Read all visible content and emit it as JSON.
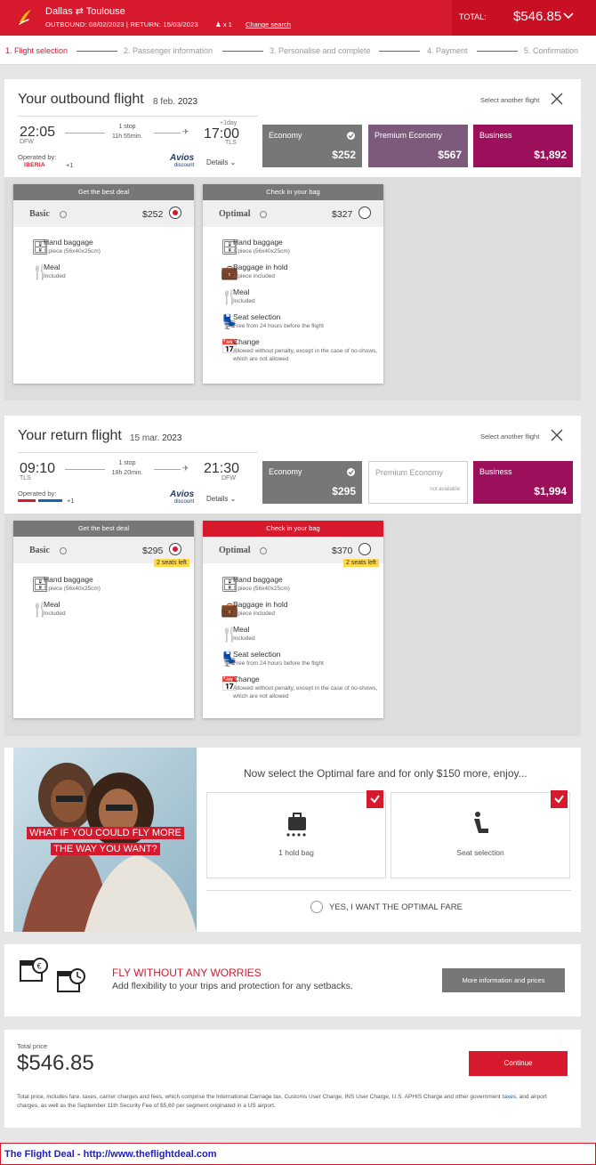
{
  "header": {
    "route": "Dallas ⇄ Toulouse",
    "dates": "OUTBOUND: 08/02/2023 | RETURN: 15/03/2023",
    "passengers": "x 1",
    "change_search": "Change search",
    "total_label": "TOTAL:",
    "total_value": "$546.85",
    "brand_color": "#d7192d"
  },
  "steps": [
    {
      "label": "1. Flight selection",
      "active": true
    },
    {
      "label": "2. Passenger information"
    },
    {
      "label": "3. Personalise and complete"
    },
    {
      "label": "4. Payment"
    },
    {
      "label": "5. Confirmation"
    }
  ],
  "outbound": {
    "title": "Your outbound flight",
    "date_a": "8 feb.",
    "date_b": "2023",
    "select_another": "Select another flight",
    "dep_time": "22:05",
    "dep_airport": "DFW",
    "stops": "1 stop",
    "duration": "11h 55min.",
    "plus_day": "+1day",
    "arr_time": "17:00",
    "arr_airport": "TLS",
    "operated_by": "Operated by:",
    "airline": "IBERIA",
    "plus": "+1",
    "avios": "Avios",
    "avios_sub": "discount",
    "details": "Details ⌄",
    "cabins": [
      {
        "name": "Economy",
        "price": "$252",
        "color": "#777777"
      },
      {
        "name": "Premium Economy",
        "price": "$567",
        "color": "#7d5a7b"
      },
      {
        "name": "Business",
        "price": "$1,892",
        "color": "#9c0f5a"
      }
    ],
    "fares": [
      {
        "header": "Get the best deal",
        "name": "Basic",
        "price": "$252",
        "features": [
          {
            "t": "Hand baggage",
            "d": "1 piece (56x40x25cm)"
          },
          {
            "t": "Meal",
            "d": "Included"
          }
        ]
      },
      {
        "header": "Check in your bag",
        "name": "Optimal",
        "price": "$327",
        "features": [
          {
            "t": "Hand baggage",
            "d": "1 piece (56x40x25cm)"
          },
          {
            "t": "Baggage in hold",
            "d": "1 piece included"
          },
          {
            "t": "Meal",
            "d": "Included"
          },
          {
            "t": "Seat selection",
            "d": "Free from 24 hours before the flight"
          },
          {
            "t": "Change",
            "d": "Allowed without penalty, except in the case of no-shows, which are not allowed"
          }
        ]
      }
    ]
  },
  "return": {
    "title": "Your return flight",
    "date_a": "15 mar.",
    "date_b": "2023",
    "select_another": "Select another flight",
    "dep_time": "09:10",
    "dep_airport": "TLS",
    "stops": "1 stop",
    "duration": "18h 20min.",
    "arr_time": "21:30",
    "arr_airport": "DFW",
    "operated_by": "Operated by:",
    "plus": "+1",
    "avios": "Avios",
    "avios_sub": "discount",
    "details": "Details ⌄",
    "cabins": [
      {
        "name": "Economy",
        "price": "$295",
        "color": "#777777"
      },
      {
        "name": "Premium Economy",
        "not_available": "not available"
      },
      {
        "name": "Business",
        "price": "$1,994",
        "color": "#9c0f5a"
      }
    ],
    "fares": [
      {
        "header": "Get the best deal",
        "name": "Basic",
        "price": "$295",
        "seats": "2 seats left",
        "features": [
          {
            "t": "Hand baggage",
            "d": "1 piece (56x40x25cm)"
          },
          {
            "t": "Meal",
            "d": "Included"
          }
        ]
      },
      {
        "header": "Check in your bag",
        "name": "Optimal",
        "price": "$370",
        "seats": "2 seats left",
        "features": [
          {
            "t": "Hand baggage",
            "d": "1 piece (56x40x25cm)"
          },
          {
            "t": "Baggage in hold",
            "d": "1 piece included"
          },
          {
            "t": "Meal",
            "d": "Included"
          },
          {
            "t": "Seat selection",
            "d": "Free from 24 hours before the flight"
          },
          {
            "t": "Change",
            "d": "Allowed without penalty, except in the case of no-shows, which are not allowed"
          }
        ]
      }
    ]
  },
  "promo": {
    "line1": "WHAT IF YOU COULD FLY MORE",
    "line2": "THE WAY YOU WANT?",
    "heading": "Now select the Optimal fare and for only $150 more, enjoy...",
    "box1": "1 hold bag",
    "box2": "Seat selection",
    "want": "YES, I WANT THE OPTIMAL FARE"
  },
  "insurance": {
    "heading": "FLY WITHOUT ANY WORRIES",
    "sub": "Add flexibility to your trips and protection for any setbacks.",
    "button": "More information and prices"
  },
  "total": {
    "label": "Total price",
    "value": "$546.85",
    "button": "Continue",
    "note_a": "Total price, includes fare, taxes, carrier charges and fees, which comprise the International Carriage tax, Customs User Charge, INS User Charge, U.S. APHIS Charge and other government ",
    "note_link": "taxes",
    "note_b": ", and airport charges, as well as the September 11th Security Fee of $5,60 per segment originated in a US airport."
  },
  "footer": "The Flight Deal - http://www.theflightdeal.com"
}
